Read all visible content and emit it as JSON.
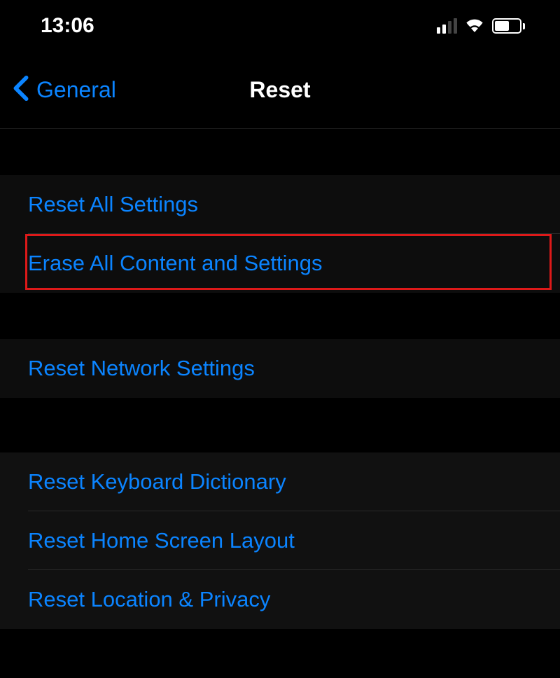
{
  "statusBar": {
    "time": "13:06"
  },
  "nav": {
    "backLabel": "General",
    "title": "Reset"
  },
  "groups": [
    {
      "items": [
        {
          "id": "reset-all-settings",
          "label": "Reset All Settings"
        },
        {
          "id": "erase-all-content",
          "label": "Erase All Content and Settings"
        }
      ]
    },
    {
      "items": [
        {
          "id": "reset-network",
          "label": "Reset Network Settings"
        }
      ]
    },
    {
      "items": [
        {
          "id": "reset-keyboard",
          "label": "Reset Keyboard Dictionary"
        },
        {
          "id": "reset-home-screen",
          "label": "Reset Home Screen Layout"
        },
        {
          "id": "reset-location",
          "label": "Reset Location & Privacy"
        }
      ]
    }
  ]
}
